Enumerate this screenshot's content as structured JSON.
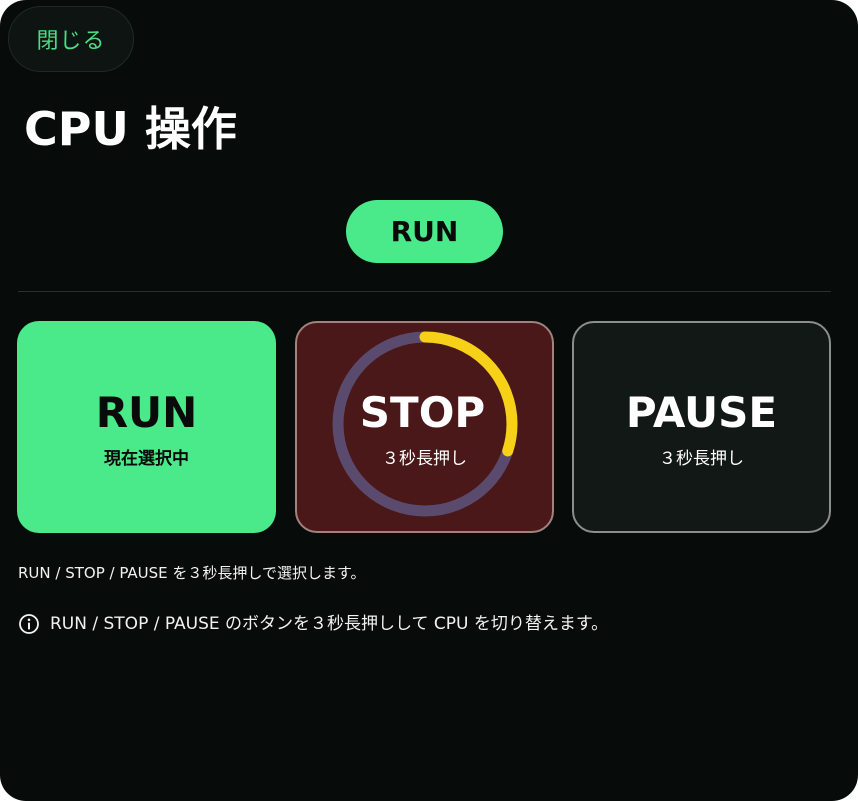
{
  "header": {
    "close_label": "閉じる",
    "title": "CPU 操作"
  },
  "status": {
    "current_mode": "RUN"
  },
  "modes": [
    {
      "label": "RUN",
      "sub": "現在選択中",
      "selected": true
    },
    {
      "label": "STOP",
      "sub": "３秒長押し",
      "hold_progress": 0.3
    },
    {
      "label": "PAUSE",
      "sub": "３秒長押し"
    }
  ],
  "hint": "RUN / STOP / PAUSE を３秒長押しで選択します。",
  "info": {
    "icon": "info-icon",
    "text": "RUN / STOP / PAUSE のボタンを３秒長押しして CPU を切り替えます。"
  },
  "colors": {
    "accent_green": "#4ae98a",
    "stop_bg": "#4a1818",
    "progress_yellow": "#f7d117",
    "ring_track": "#5a4a6e",
    "pause_bg": "#121815"
  }
}
